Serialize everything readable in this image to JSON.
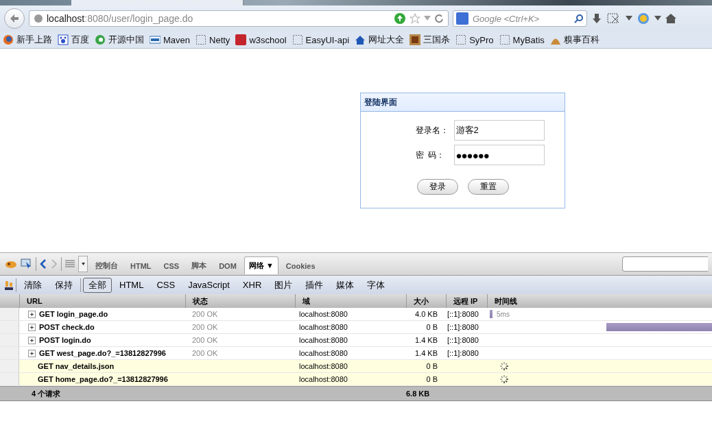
{
  "browser": {
    "url": {
      "host": "localhost",
      "rest": ":8080/user/login_page.do"
    },
    "search": {
      "placeholder": "Google <Ctrl+K>"
    },
    "bookmarks": [
      "新手上路",
      "百度",
      "开源中国",
      "Maven",
      "Netty",
      "w3school",
      "EasyUI-api",
      "网址大全",
      "三国杀",
      "SyPro",
      "MyBatis",
      "糗事百科"
    ]
  },
  "login": {
    "title": "登陆界面",
    "fields": [
      {
        "label": "登录名：",
        "value": "游客2"
      },
      {
        "label": "密  码：",
        "value": "●●●●●●"
      }
    ],
    "buttons": [
      "登录",
      "重置"
    ]
  },
  "devtools": {
    "tabs": [
      {
        "label": "控制台",
        "selected": false
      },
      {
        "label": "HTML",
        "selected": false
      },
      {
        "label": "CSS",
        "selected": false
      },
      {
        "label": "脚本",
        "selected": false
      },
      {
        "label": "DOM",
        "selected": false
      },
      {
        "label": "网络",
        "selected": true,
        "caret": "▼"
      },
      {
        "label": "Cookies",
        "selected": false
      }
    ],
    "actions": [
      "清除",
      "保持"
    ],
    "filters": [
      {
        "label": "全部",
        "selected": true
      },
      {
        "label": "HTML",
        "selected": false
      },
      {
        "label": "CSS",
        "selected": false
      },
      {
        "label": "JavaScript",
        "selected": false
      },
      {
        "label": "XHR",
        "selected": false
      },
      {
        "label": "图片",
        "selected": false
      },
      {
        "label": "插件",
        "selected": false
      },
      {
        "label": "媒体",
        "selected": false
      },
      {
        "label": "字体",
        "selected": false
      }
    ],
    "columns": [
      "URL",
      "状态",
      "域",
      "大小",
      "远程 IP",
      "时间线"
    ],
    "rows": [
      {
        "kind": "done",
        "url": "GET login_page.do",
        "status": "200 OK",
        "domain": "localhost:8080",
        "size": "4.0 KB",
        "ip": "[::1]:8080",
        "timing": "5ms"
      },
      {
        "kind": "done",
        "url": "POST check.do",
        "status": "200 OK",
        "domain": "localhost:8080",
        "size": "0 B",
        "ip": "[::1]:8080"
      },
      {
        "kind": "done",
        "url": "POST login.do",
        "status": "200 OK",
        "domain": "localhost:8080",
        "size": "1.4 KB",
        "ip": "[::1]:8080"
      },
      {
        "kind": "done",
        "url": "GET west_page.do?_=13812827996",
        "status": "200 OK",
        "domain": "localhost:8080",
        "size": "1.4 KB",
        "ip": "[::1]:8080"
      },
      {
        "kind": "pending",
        "url": "GET nav_details.json",
        "domain": "localhost:8080",
        "size": "0 B"
      },
      {
        "kind": "pending",
        "url": "GET home_page.do?_=13812827996",
        "domain": "localhost:8080",
        "size": "0 B"
      }
    ],
    "summary": {
      "count": "4 个请求",
      "total": "6.8 KB"
    }
  }
}
